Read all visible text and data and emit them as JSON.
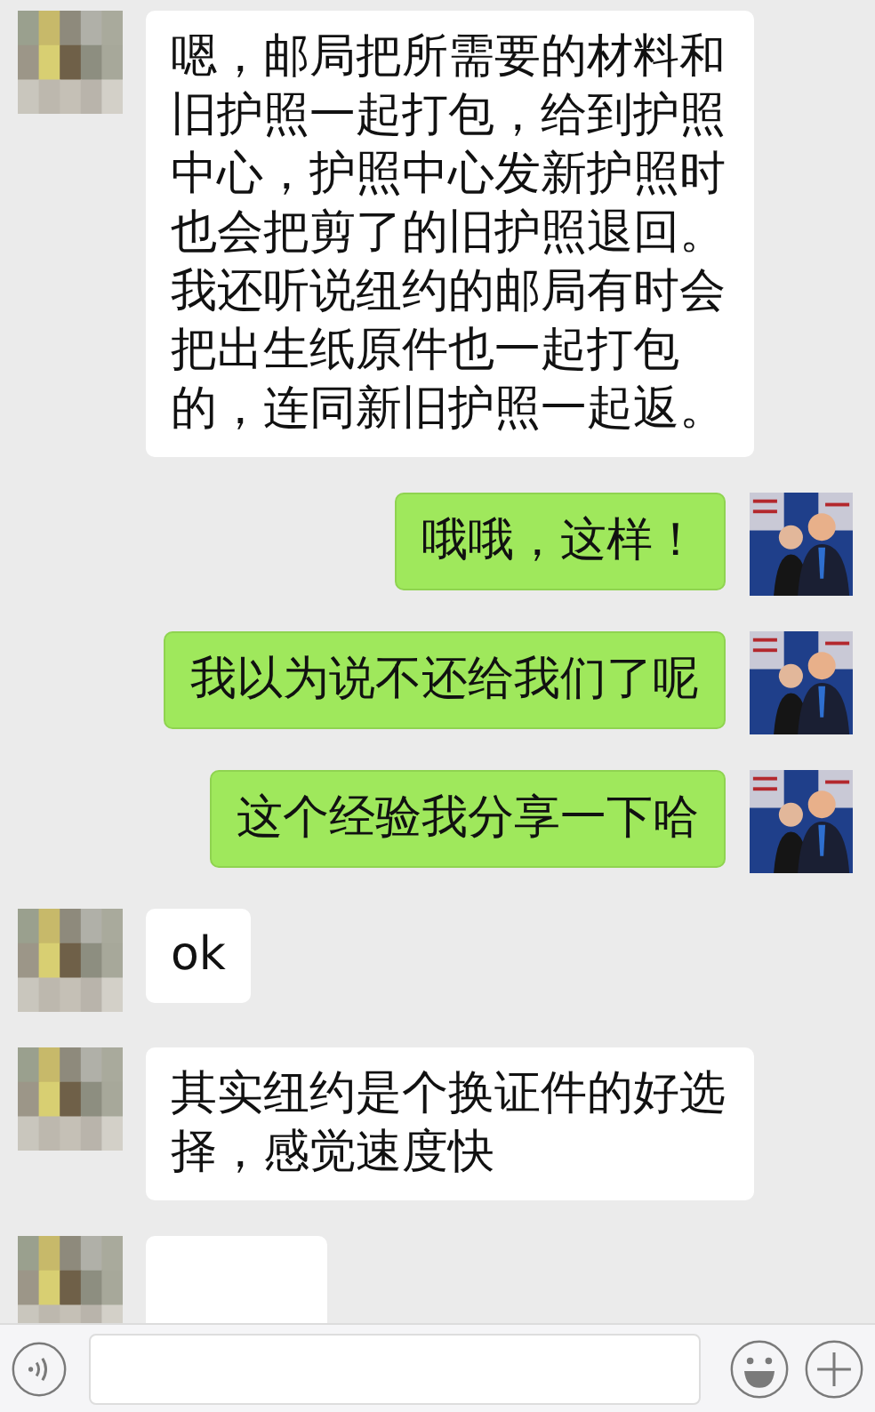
{
  "messages": [
    {
      "kind": "left",
      "text": "嗯，邮局把所需要的材料和旧护照一起打包，给到护照中心，护照中心发新护照时也会把剪了的旧护照退回。我还听说纽约的邮局有时会把出生纸原件也一起打包的，连同新旧护照一起返。"
    },
    {
      "kind": "right",
      "text": "哦哦，这样！"
    },
    {
      "kind": "right",
      "text": "我以为说不还给我们了呢"
    },
    {
      "kind": "right",
      "text": "这个经验我分享一下哈"
    },
    {
      "kind": "left",
      "text": "ok"
    },
    {
      "kind": "left",
      "text": "其实纽约是个换证件的好选择，感觉速度快"
    },
    {
      "kind": "left"
    }
  ]
}
